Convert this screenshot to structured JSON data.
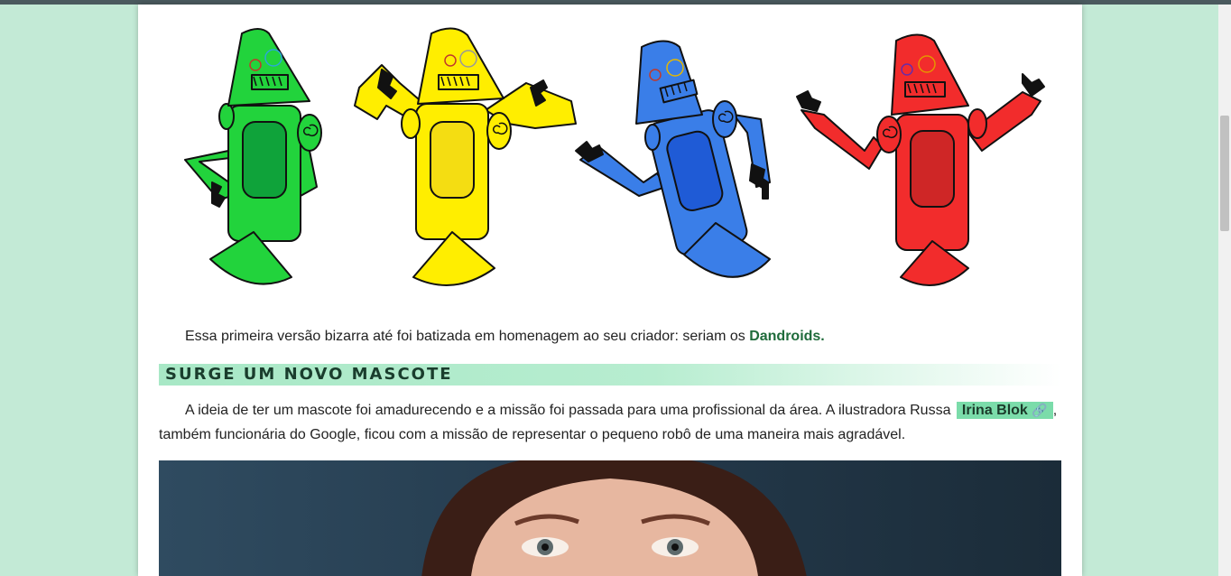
{
  "article": {
    "image_alt": "Dandroids",
    "paragraph1_text": "Essa primeira versão bizarra até foi batizada em homenagem ao seu criador: seriam os ",
    "paragraph1_link": "Dandroids.",
    "section_heading": "Surge um novo mascote",
    "paragraph2_text_a": "A ideia de ter um mascote foi amadurecendo e a missão foi passada para uma profissional da área. A ilustradora Russa ",
    "paragraph2_link": "Irina Blok",
    "paragraph2_link_icon": "chain-link-icon",
    "paragraph2_text_b": ",",
    "paragraph2_text_c": "também funcionária do Google, ficou com a missão de representar o pequeno robô de uma maneira mais agradável.",
    "photo_alt": "Irina Blok"
  },
  "colors": {
    "page_bg": "#c3ead6",
    "heading_gradient": "#a8e8c6",
    "link": "#1f6b3b",
    "highlight": "#7bdcaa",
    "robot_green": "#22d33c",
    "robot_yellow": "#ffee00",
    "robot_blue": "#3a7ee8",
    "robot_red": "#f22c2c"
  }
}
